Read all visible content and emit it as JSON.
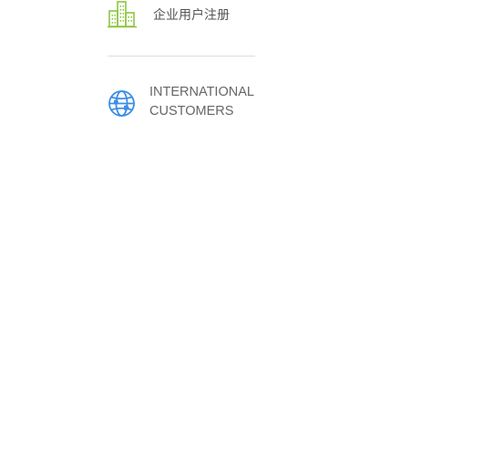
{
  "menu": {
    "items": [
      {
        "icon": "building-icon",
        "label": "企业用户注册",
        "color": "#8cc63f"
      },
      {
        "icon": "globe-icon",
        "label_line1": "INTERNATIONAL",
        "label_line2": "CUSTOMERS",
        "color": "#3a8ee6"
      }
    ]
  }
}
